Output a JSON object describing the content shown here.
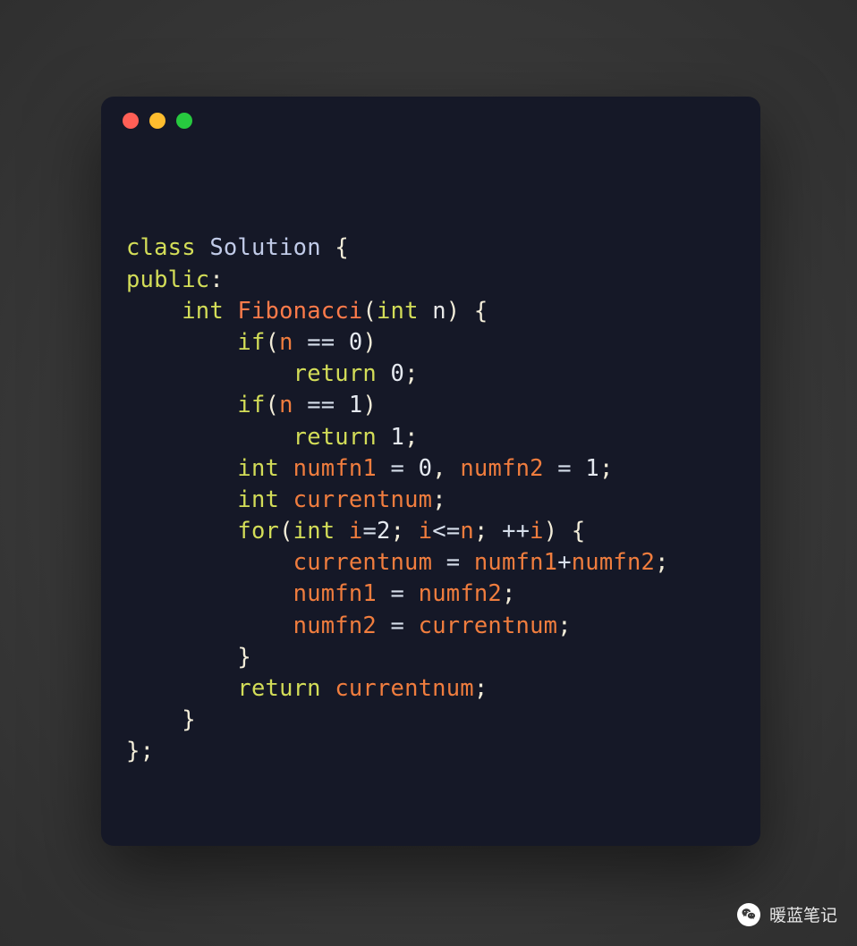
{
  "window": {
    "dots": [
      "red",
      "yellow",
      "green"
    ]
  },
  "code": {
    "class_kw": "class",
    "class_name": "Solution",
    "open_brace": "{",
    "public_kw": "public",
    "colon": ":",
    "ret_type": "int",
    "fn_name": "Fibonacci",
    "param_type": "int",
    "param_name": "n",
    "close_paren": ")",
    "open_paren": "(",
    "if_kw": "if",
    "eq_op": "==",
    "zero": "0",
    "one": "1",
    "two": "2",
    "return_kw": "return",
    "semi": ";",
    "int_kw": "int",
    "numfn1": "numfn1",
    "numfn2": "numfn2",
    "currentnum": "currentnum",
    "assign": "=",
    "comma": ",",
    "for_kw": "for",
    "i": "i",
    "le_op": "<=",
    "inc_op": "++",
    "plus": "+",
    "close_brace": "}",
    "end_semi": ";"
  },
  "watermark": {
    "text": "暖蓝笔记",
    "icon": "wechat-icon"
  }
}
